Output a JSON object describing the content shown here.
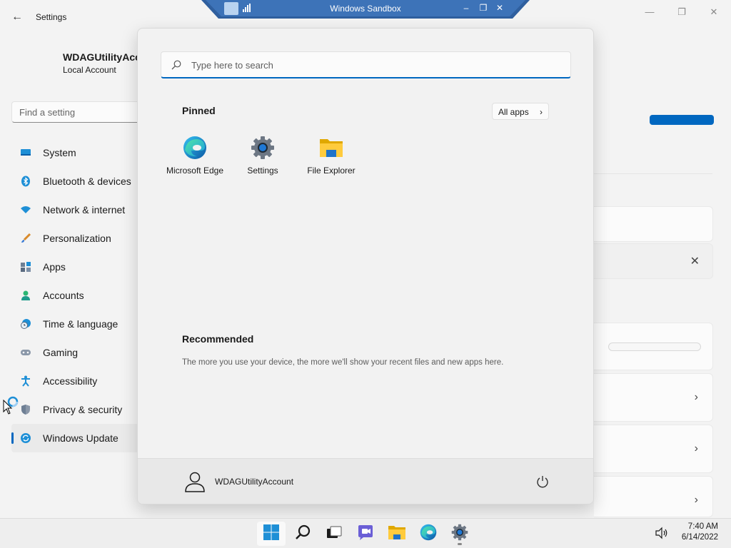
{
  "settings": {
    "title": "Settings",
    "account_name": "WDAGUtilityAcc",
    "account_type": "Local Account",
    "search_placeholder": "Find a setting",
    "nav": [
      {
        "label": "System",
        "icon": "monitor-icon"
      },
      {
        "label": "Bluetooth & devices",
        "icon": "bluetooth-icon"
      },
      {
        "label": "Network & internet",
        "icon": "wifi-icon"
      },
      {
        "label": "Personalization",
        "icon": "paintbrush-icon"
      },
      {
        "label": "Apps",
        "icon": "apps-icon"
      },
      {
        "label": "Accounts",
        "icon": "person-icon"
      },
      {
        "label": "Time & language",
        "icon": "clock-globe-icon"
      },
      {
        "label": "Gaming",
        "icon": "gamepad-icon"
      },
      {
        "label": "Accessibility",
        "icon": "accessibility-icon"
      },
      {
        "label": "Privacy & security",
        "icon": "shield-icon"
      },
      {
        "label": "Windows Update",
        "icon": "update-icon"
      }
    ],
    "active_nav": "Windows Update",
    "accent_color": "#0067c0"
  },
  "sandbox": {
    "title": "Windows Sandbox"
  },
  "start_menu": {
    "search_placeholder": "Type here to search",
    "pinned_title": "Pinned",
    "all_apps_label": "All apps",
    "pinned_apps": [
      {
        "label": "Microsoft Edge",
        "icon": "edge-icon"
      },
      {
        "label": "Settings",
        "icon": "gear-icon"
      },
      {
        "label": "File Explorer",
        "icon": "folder-icon"
      }
    ],
    "recommended_title": "Recommended",
    "recommended_text": "The more you use your device, the more we'll show your recent files and new apps here.",
    "user_name": "WDAGUtilityAccount"
  },
  "taskbar": {
    "items": [
      "start-icon",
      "search-icon",
      "task-view-icon",
      "chat-icon",
      "file-explorer-icon",
      "edge-icon",
      "settings-icon"
    ],
    "time": "7:40 AM",
    "date": "6/14/2022"
  }
}
